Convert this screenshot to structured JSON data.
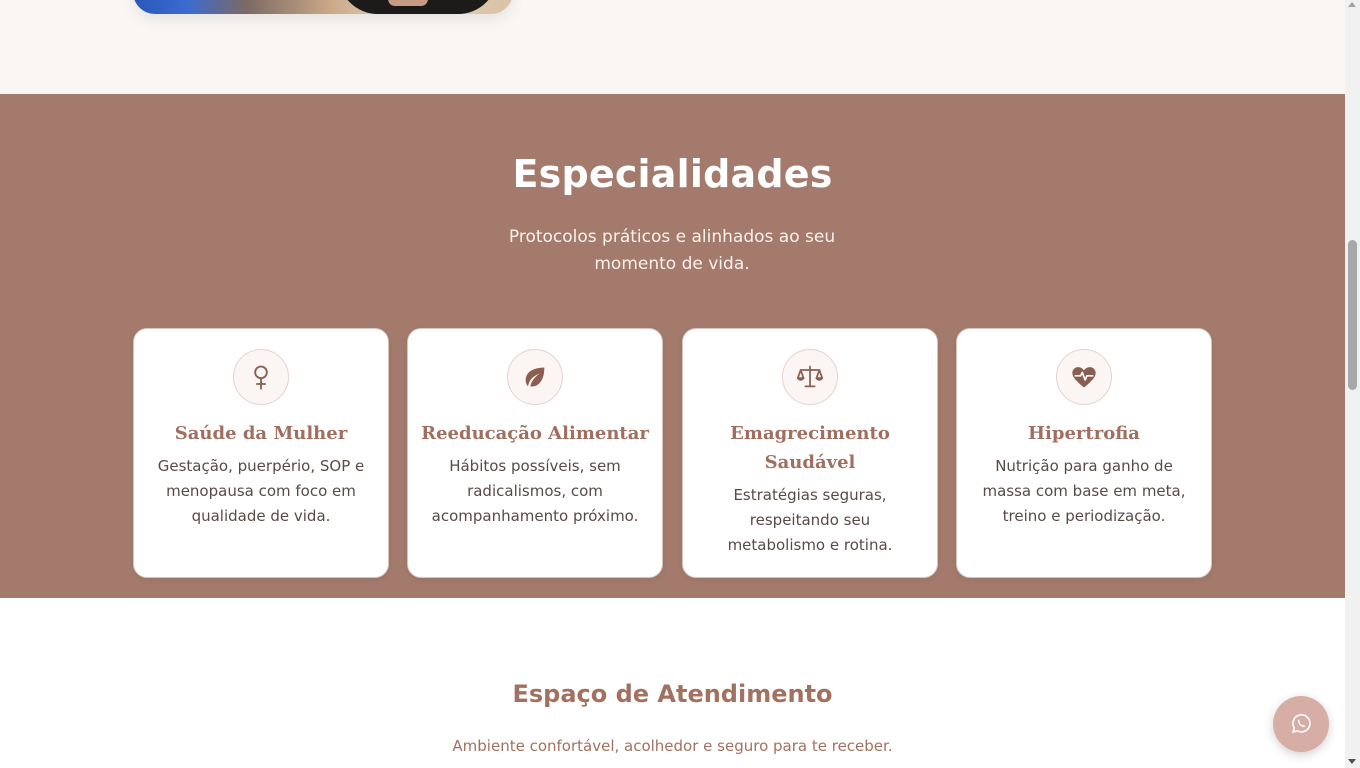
{
  "specialties": {
    "title": "Especialidades",
    "subtitle": "Protocolos práticos e alinhados ao seu momento de vida.",
    "cards": [
      {
        "icon": "venus-icon",
        "title": "Saúde da Mulher",
        "description": "Gestação, puerpério, SOP e menopausa com foco em qualidade de vida."
      },
      {
        "icon": "leaf-icon",
        "title": "Reeducação Alimentar",
        "description": "Hábitos possíveis, sem radicalismos, com acompanhamento próximo."
      },
      {
        "icon": "scale-balance-icon",
        "title": "Emagrecimento Saudável",
        "description": "Estratégias seguras, respeitando seu metabolismo e rotina."
      },
      {
        "icon": "heart-pulse-icon",
        "title": "Hipertrofia",
        "description": "Nutrição para ganho de massa com base em meta, treino e periodização."
      }
    ]
  },
  "espaco": {
    "title": "Espaço de Atendimento",
    "subtitle": "Ambiente confortável, acolhedor e seguro para te receber."
  },
  "whatsapp": {
    "icon": "whatsapp-icon"
  },
  "colors": {
    "section_bg": "#a37a6b",
    "accent": "#a06f5f",
    "card_bg": "#ffffff",
    "whatsapp_bg": "#d6aea5"
  }
}
